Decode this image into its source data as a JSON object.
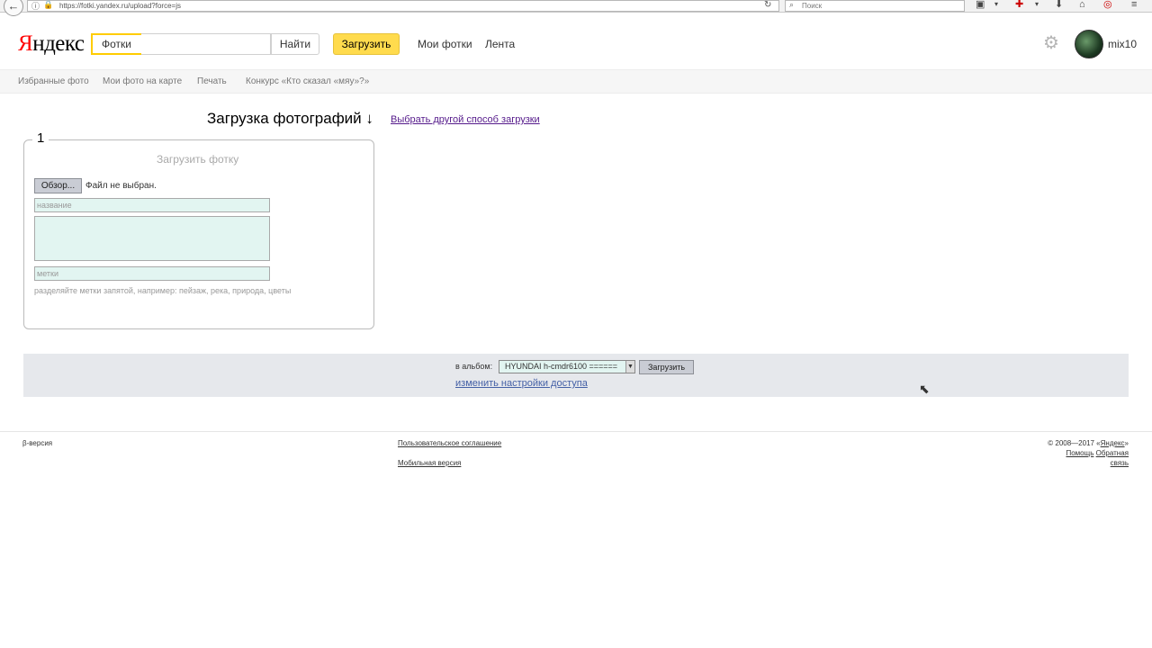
{
  "browser": {
    "url": "https://fotki.yandex.ru/upload?force=js",
    "search_placeholder": "Поиск"
  },
  "header": {
    "logo_first": "Я",
    "logo_rest": "ндекс",
    "service": "Фотки",
    "find_label": "Найти",
    "upload_label": "Загрузить",
    "nav": [
      "Мои фотки",
      "Лента"
    ],
    "username": "mix10"
  },
  "subnav": [
    "Избранные фото",
    "Мои фото на карте",
    "Печать",
    "Конкурс «Кто сказал «мяу»?»"
  ],
  "upload": {
    "title": "Загрузка фотографий ↓",
    "other_way": "Выбрать другой способ загрузки",
    "panel_number": "1",
    "panel_heading": "Загрузить фотку",
    "browse_label": "Обзор...",
    "file_status": "Файл не выбран.",
    "title_placeholder": "название",
    "tags_placeholder": "метки",
    "tags_hint": "разделяйте метки запятой, например: пейзаж, река, природа, цветы"
  },
  "album": {
    "label": "в альбом:",
    "selected": "HYUNDAI h-cmdr6100 ======",
    "upload_label": "Загрузить",
    "access_link": "изменить настройки доступа"
  },
  "footer": {
    "beta": "β-версия",
    "agreement": "Пользовательское соглашение",
    "mobile": "Мобильная версия",
    "copyright": "© 2008—2017 «",
    "yandex": "Яндекс",
    "copyright_end": "»",
    "help": "Помощь",
    "feedback_1": "Обратная",
    "feedback_2": "связь"
  }
}
